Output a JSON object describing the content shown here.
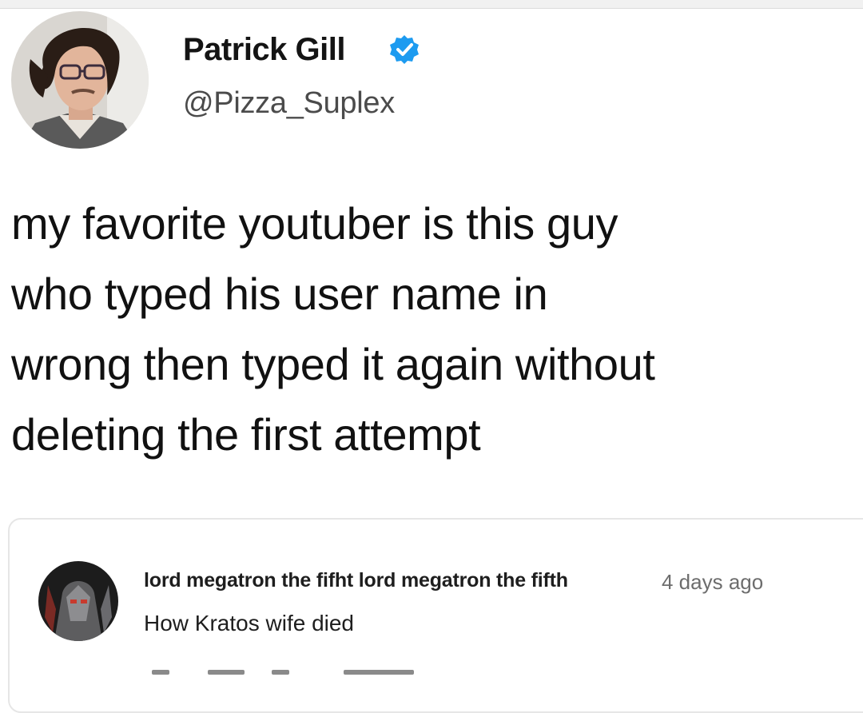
{
  "tweet": {
    "display_name": "Patrick Gill",
    "handle": "@Pizza_Suplex",
    "verified_icon": "verified-badge-icon",
    "text_lines": [
      "my favorite youtuber is this guy",
      "who typed his user name in",
      "wrong then typed it again without",
      "deleting the first attempt"
    ]
  },
  "comment": {
    "author": "lord megatron the fifht lord megatron the fifth",
    "time": "4 days ago",
    "text": "How Kratos wife died",
    "actions": [
      "thumbs-up-icon",
      "like-count",
      "thumbs-down-icon",
      "reply-button"
    ]
  },
  "colors": {
    "verified_blue": "#1d9bf0",
    "text": "#111111",
    "secondary": "#6d6d6d",
    "card_border": "#e6e6e6"
  }
}
